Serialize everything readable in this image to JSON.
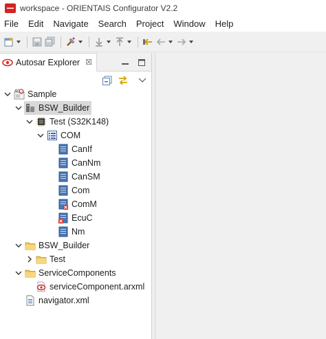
{
  "window": {
    "title": "workspace - ORIENTAIS Configurator V2.2"
  },
  "menu": [
    "File",
    "Edit",
    "Navigate",
    "Search",
    "Project",
    "Window",
    "Help"
  ],
  "view": {
    "tab_label": "Autosar Explorer",
    "close_glyph": "☒"
  },
  "tree": [
    {
      "label": "Sample",
      "icon": "project-icon",
      "expanded": true
    },
    {
      "label": "BSW_Builder",
      "icon": "builder-icon",
      "expanded": true,
      "selected": true
    },
    {
      "label": "Test (S32K148)",
      "icon": "chip-icon",
      "expanded": true
    },
    {
      "label": "COM",
      "icon": "module-list-icon",
      "expanded": true
    },
    {
      "label": "CanIf",
      "icon": "module-icon"
    },
    {
      "label": "CanNm",
      "icon": "module-icon"
    },
    {
      "label": "CanSM",
      "icon": "module-icon"
    },
    {
      "label": "Com",
      "icon": "module-icon"
    },
    {
      "label": "ComM",
      "icon": "module-error-icon"
    },
    {
      "label": "EcuC",
      "icon": "module-error-icon"
    },
    {
      "label": "Nm",
      "icon": "module-icon"
    },
    {
      "label": "BSW_Builder",
      "icon": "folder-icon",
      "expanded": true
    },
    {
      "label": "Test",
      "icon": "folder-icon",
      "expanded": false
    },
    {
      "label": "ServiceComponents",
      "icon": "folder-icon",
      "expanded": true
    },
    {
      "label": "serviceComponent.arxml",
      "icon": "arxml-icon"
    },
    {
      "label": "navigator.xml",
      "icon": "xml-file-icon"
    }
  ]
}
